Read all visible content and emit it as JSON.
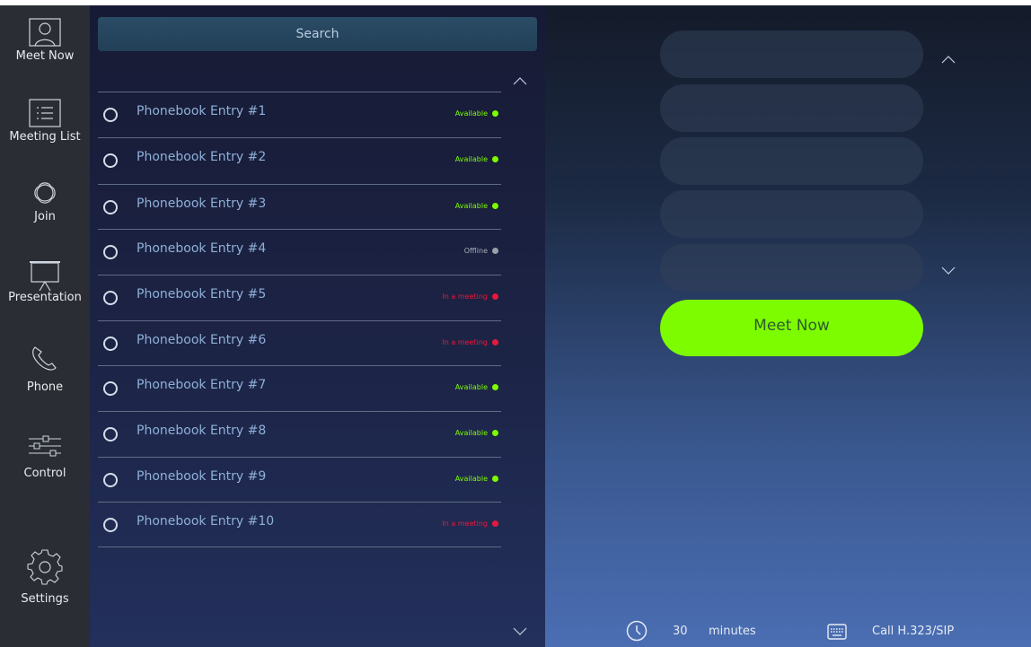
{
  "sidebar": {
    "items": [
      {
        "label": "Meet Now",
        "icon": "person-icon"
      },
      {
        "label": "Meeting List",
        "icon": "list-icon"
      },
      {
        "label": "Join",
        "icon": "join-icon"
      },
      {
        "label": "Presentation",
        "icon": "presentation-icon"
      },
      {
        "label": "Phone",
        "icon": "phone-icon"
      },
      {
        "label": "Control",
        "icon": "sliders-icon"
      },
      {
        "label": "Settings",
        "icon": "gear-icon"
      }
    ]
  },
  "phonebook": {
    "search_label": "Search",
    "entries": [
      {
        "name": "Phonebook Entry #1",
        "status": "Available",
        "color": "#7dfc00"
      },
      {
        "name": "Phonebook Entry #2",
        "status": "Available",
        "color": "#7dfc00"
      },
      {
        "name": "Phonebook Entry #3",
        "status": "Available",
        "color": "#7dfc00"
      },
      {
        "name": "Phonebook Entry #4",
        "status": "Offline",
        "color": "#9aa0aa"
      },
      {
        "name": "Phonebook Entry #5",
        "status": "In a meeting",
        "color": "#e8193c"
      },
      {
        "name": "Phonebook Entry #6",
        "status": "In a meeting",
        "color": "#e8193c"
      },
      {
        "name": "Phonebook Entry #7",
        "status": "Available",
        "color": "#7dfc00"
      },
      {
        "name": "Phonebook Entry #8",
        "status": "Available",
        "color": "#7dfc00"
      },
      {
        "name": "Phonebook Entry #9",
        "status": "Available",
        "color": "#7dfc00"
      },
      {
        "name": "Phonebook Entry #10",
        "status": "In a meeting",
        "color": "#e8193c"
      }
    ]
  },
  "meet": {
    "button_label": "Meet Now",
    "duration_value": "30",
    "duration_unit": "minutes",
    "call_label": "Call H.323/SIP"
  },
  "colors": {
    "accent": "#7dfc00",
    "available": "#7dfc00",
    "offline": "#9aa0aa",
    "busy": "#e8193c"
  }
}
